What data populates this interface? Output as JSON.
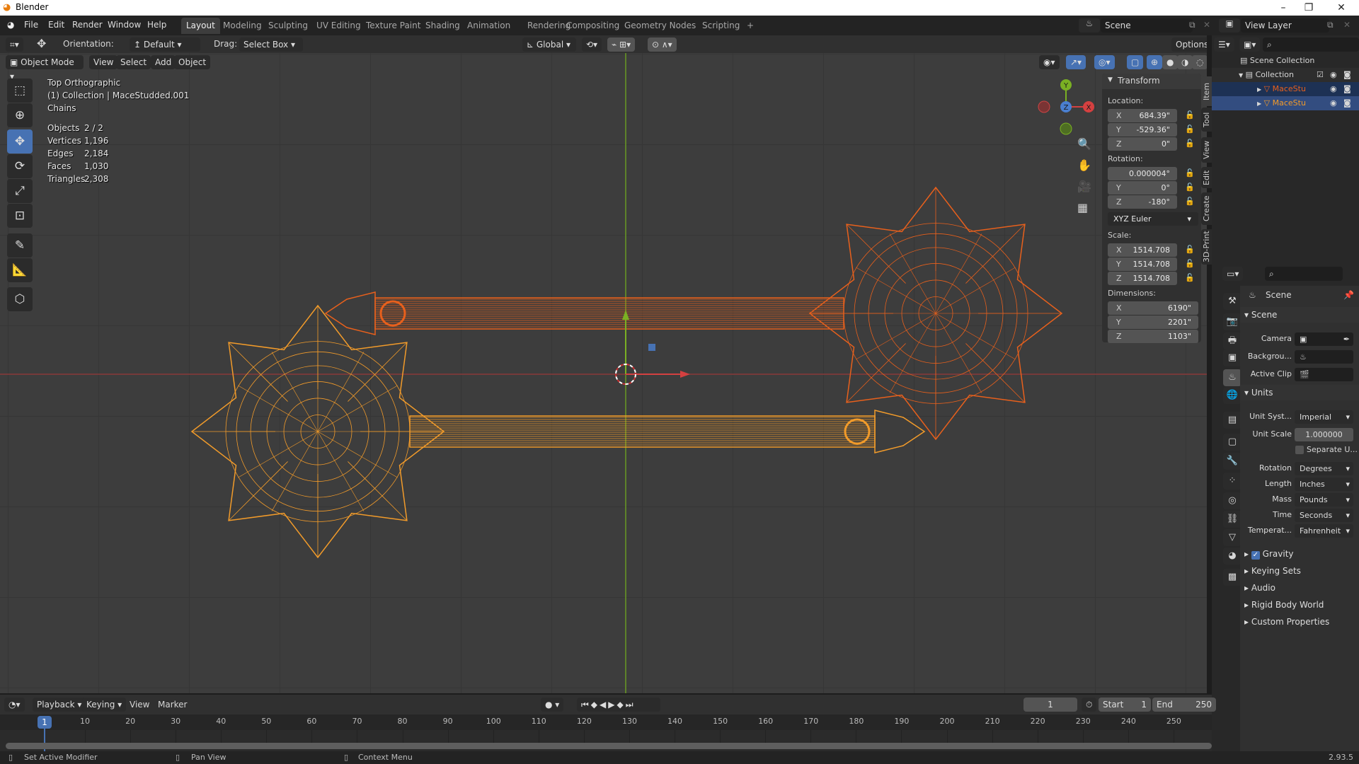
{
  "window": {
    "title": "Blender",
    "minimize": "–",
    "restore": "❐",
    "close": "✕"
  },
  "menu": [
    "File",
    "Edit",
    "Render",
    "Window",
    "Help"
  ],
  "workspaces": [
    {
      "label": "Layout",
      "active": true
    },
    {
      "label": "Modeling"
    },
    {
      "label": "Sculpting"
    },
    {
      "label": "UV Editing"
    },
    {
      "label": "Texture Paint"
    },
    {
      "label": "Shading"
    },
    {
      "label": "Animation"
    },
    {
      "label": "Rendering"
    },
    {
      "label": "Compositing"
    },
    {
      "label": "Geometry Nodes"
    },
    {
      "label": "Scripting"
    }
  ],
  "add_workspace": "+",
  "scene": {
    "name": "Scene",
    "view_layer": "View Layer"
  },
  "tool_header": {
    "orientation_label": "Orientation:",
    "orientation": "Default",
    "drag_label": "Drag:",
    "drag": "Select Box",
    "transform_orientation": "Global",
    "options": "Options"
  },
  "viewport_header": {
    "mode": "Object Mode",
    "menus": [
      "View",
      "Select",
      "Add",
      "Object"
    ]
  },
  "overlay": {
    "view": "Top Orthographic",
    "collection": "(1) Collection | MaceStudded.001",
    "chains": "Chains",
    "stats": [
      {
        "label": "Objects",
        "value": "2 / 2"
      },
      {
        "label": "Vertices",
        "value": "1,196"
      },
      {
        "label": "Edges",
        "value": "2,184"
      },
      {
        "label": "Faces",
        "value": "1,030"
      },
      {
        "label": "Triangles",
        "value": "2,308"
      }
    ]
  },
  "gizmo": {
    "x": "X",
    "y": "Y",
    "z": "Z"
  },
  "npanel": {
    "title": "Transform",
    "location_label": "Location:",
    "location": [
      {
        "axis": "X",
        "value": "684.39\""
      },
      {
        "axis": "Y",
        "value": "-529.36\""
      },
      {
        "axis": "Z",
        "value": "0\""
      }
    ],
    "rotation_label": "Rotation:",
    "rotation": [
      {
        "axis": "",
        "value": "0.000004°"
      },
      {
        "axis": "Y",
        "value": "0°"
      },
      {
        "axis": "Z",
        "value": "-180°"
      }
    ],
    "rotation_mode": "XYZ Euler",
    "scale_label": "Scale:",
    "scale": [
      {
        "axis": "X",
        "value": "1514.708"
      },
      {
        "axis": "Y",
        "value": "1514.708"
      },
      {
        "axis": "Z",
        "value": "1514.708"
      }
    ],
    "dimensions_label": "Dimensions:",
    "dimensions": [
      {
        "axis": "X",
        "value": "6190\""
      },
      {
        "axis": "Y",
        "value": "2201\""
      },
      {
        "axis": "Z",
        "value": "1103\""
      }
    ],
    "tabs": [
      "Item",
      "Tool",
      "View",
      "Edit",
      "Create",
      "3D-Print"
    ]
  },
  "outliner": {
    "root": "Scene Collection",
    "collection": "Collection",
    "objects": [
      "MaceStu",
      "MaceStu"
    ]
  },
  "properties": {
    "context": "Scene",
    "scene_section": "Scene",
    "camera_label": "Camera",
    "background_label": "Backgrou...",
    "active_clip_label": "Active Clip",
    "units_section": "Units",
    "unit_system_label": "Unit Syst...",
    "unit_system": "Imperial",
    "unit_scale_label": "Unit Scale",
    "unit_scale": "1.000000",
    "separate_units": "Separate U...",
    "rotation_label": "Rotation",
    "rotation": "Degrees",
    "length_label": "Length",
    "length": "Inches",
    "mass_label": "Mass",
    "mass": "Pounds",
    "time_label": "Time",
    "time": "Seconds",
    "temperature_label": "Temperat...",
    "temperature": "Fahrenheit",
    "gravity": "Gravity",
    "gravity_checked": true,
    "collapsed": [
      "Keying Sets",
      "Audio",
      "Rigid Body World",
      "Custom Properties"
    ]
  },
  "timeline": {
    "menus": [
      "Playback",
      "Keying",
      "View",
      "Marker"
    ],
    "current_frame": "1",
    "start_label": "Start",
    "start": "1",
    "end_label": "End",
    "end": "250",
    "ticks": [
      "10",
      "20",
      "30",
      "40",
      "50",
      "60",
      "70",
      "80",
      "90",
      "100",
      "110",
      "120",
      "130",
      "140",
      "150",
      "160",
      "170",
      "180",
      "190",
      "200",
      "210",
      "220",
      "230",
      "240",
      "250"
    ]
  },
  "status": {
    "left": "Set Active Modifier",
    "middle": "Pan View",
    "right": "Context Menu",
    "version": "2.93.5"
  },
  "colors": {
    "selected_active": "#e8601c",
    "selected": "#f29b2a",
    "accent": "#4772b3",
    "x_axis": "#d44040",
    "y_axis": "#7ab023",
    "z_axis": "#4a7fd0"
  }
}
